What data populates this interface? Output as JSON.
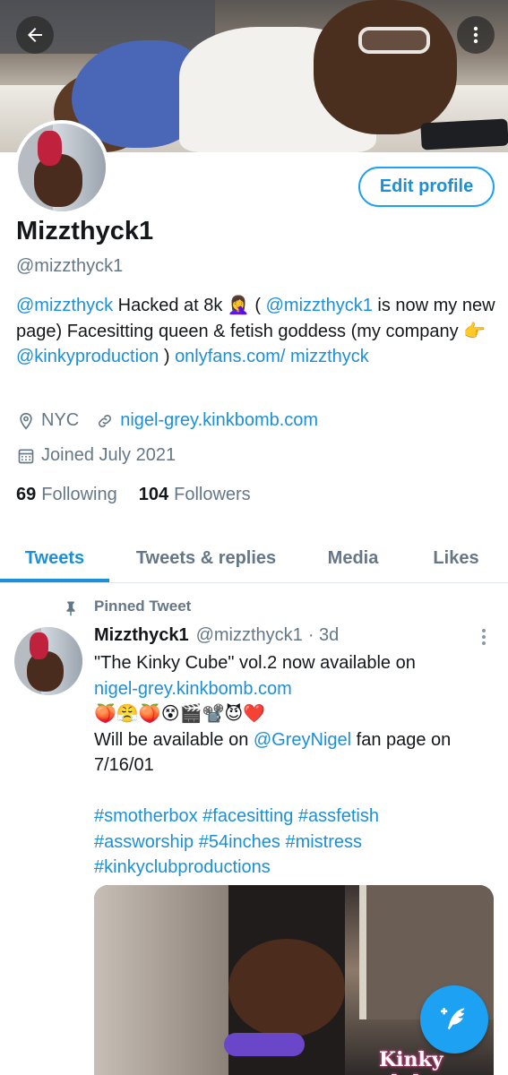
{
  "header": {
    "back_icon": "arrow-left-icon",
    "more_icon": "more-vertical-icon"
  },
  "profile": {
    "edit_label": "Edit profile",
    "display_name": "Mizzthyck1",
    "handle": "@mizzthyck1",
    "bio": {
      "mention1": "@mizzthyck",
      "text1": " Hacked at 8k 🤦‍♀️ ( ",
      "mention2": "@mizzthyck1",
      "text2": " is now my new page) Facesitting queen & fetish goddess (my company 👉 ",
      "mention3": "@kinkyproduction",
      "text3": " ) ",
      "link": "onlyfans.com/ mizzthyck"
    },
    "location": "NYC",
    "website": "nigel-grey.kinkbomb.com",
    "joined": "Joined July 2021",
    "following_count": "69",
    "following_label": "Following",
    "followers_count": "104",
    "followers_label": "Followers"
  },
  "tabs": [
    {
      "label": "Tweets",
      "active": true
    },
    {
      "label": "Tweets & replies",
      "active": false
    },
    {
      "label": "Media",
      "active": false
    },
    {
      "label": "Likes",
      "active": false
    }
  ],
  "pinned_tweet": {
    "pinned_label": "Pinned Tweet",
    "author_name": "Mizzthyck1",
    "author_handle": "@mizzthyck1",
    "time": "· 3d",
    "line1": "\"The Kinky Cube\" vol.2 now available on",
    "link1": "nigel-grey.kinkbomb.com",
    "emojis": "🍑😤🍑😵🎬📽️😈❤️",
    "line3_text": "Will be available on ",
    "line3_mention": "@GreyNigel",
    "line3_rest": " fan page on 7/16/01",
    "hashtags_1": "#smotherbox #facesitting #assfetish",
    "hashtags_2": "#assworship #54inches #mistress",
    "hashtags_3": "#kinkyclubproductions",
    "media_caption": "Kinky club"
  },
  "colors": {
    "accent": "#1da1f2",
    "link": "#1d8fd6",
    "secondary_text": "#657786"
  }
}
